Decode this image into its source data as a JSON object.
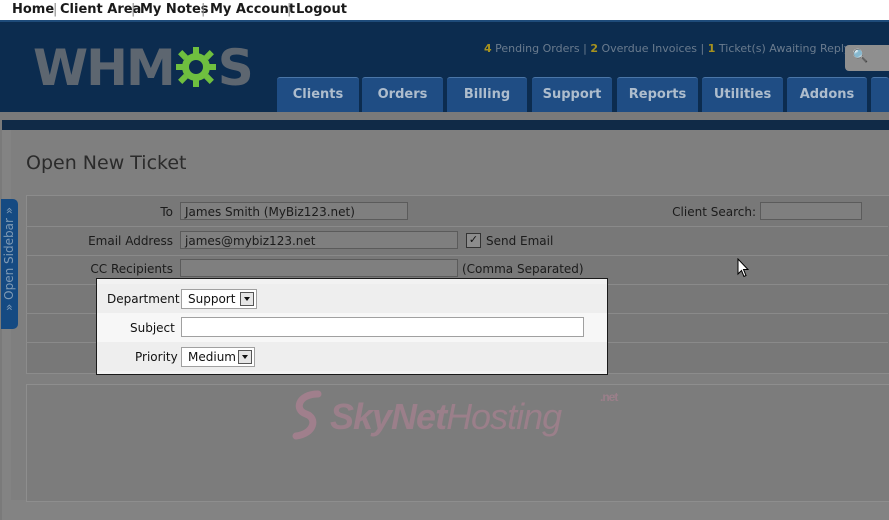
{
  "topnav": [
    "Home",
    "Client Area",
    "My Notes",
    "My Account",
    "Logout"
  ],
  "logo": {
    "text_pre": "WHM",
    "text_post": "S"
  },
  "stats": {
    "pending_orders_count": "4",
    "pending_orders_label": "Pending Orders",
    "overdue_invoices_count": "2",
    "overdue_invoices_label": "Overdue Invoices",
    "tickets_count": "1",
    "tickets_label": "Ticket(s) Awaiting Reply",
    "separator": "|"
  },
  "nav_tabs": [
    "Clients",
    "Orders",
    "Billing",
    "Support",
    "Reports",
    "Utilities",
    "Addons"
  ],
  "sidebar": {
    "label": "» Open Sidebar »"
  },
  "page": {
    "title": "Open New Ticket"
  },
  "form": {
    "to": {
      "label": "To",
      "value": "James Smith (MyBiz123.net)"
    },
    "client_search": {
      "label": "Client Search:",
      "value": ""
    },
    "email": {
      "label": "Email Address",
      "value": "james@mybiz123.net"
    },
    "send_email": {
      "label": "Send Email",
      "checked": true,
      "mark": "✓"
    },
    "cc": {
      "label": "CC Recipients",
      "value": "",
      "hint": "(Comma Separated)"
    },
    "department": {
      "label": "Department",
      "value": "Support"
    },
    "subject": {
      "label": "Subject",
      "value": ""
    },
    "priority": {
      "label": "Priority",
      "value": "Medium"
    }
  },
  "watermark": {
    "text_a": "SkyNet",
    "text_b": "Hosting",
    "suffix": ".net"
  },
  "colors": {
    "header": "#0c2c4f",
    "nav_tab": "#1f4d84",
    "stat_count": "#a7921e",
    "logo_gear": "#6fbf3f"
  },
  "icons": {
    "search": "magnifier-icon",
    "gear": "gear-icon",
    "checkbox": "checkmark-icon",
    "dropdown": "chevron-down-icon",
    "cursor": "mouse-pointer-icon"
  }
}
